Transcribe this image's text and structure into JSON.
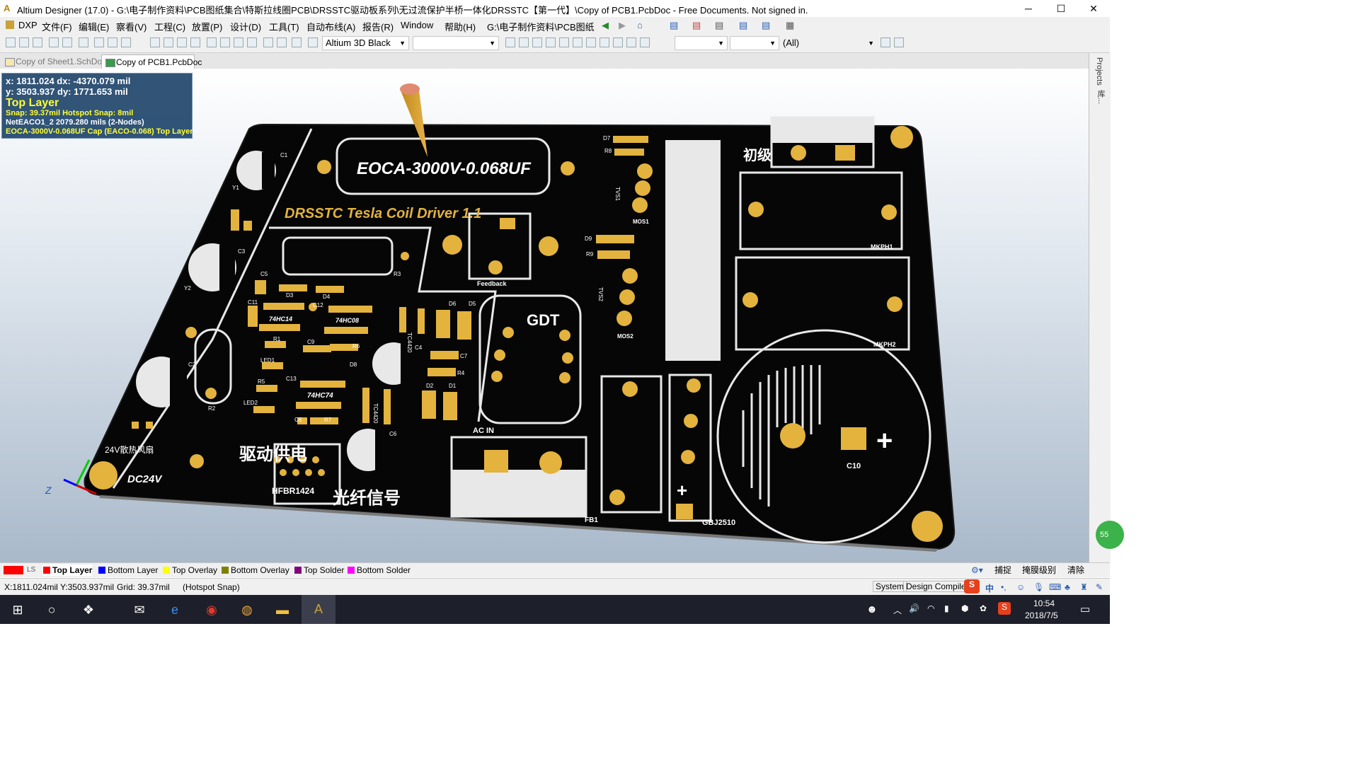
{
  "window": {
    "title": "Altium Designer (17.0) - G:\\电子制作资料\\PCB图纸集合\\特斯拉线圈PCB\\DRSSTC驱动板系列\\无过流保护半桥一体化DRSSTC【第一代】\\Copy of PCB1.PcbDoc - Free Documents. Not signed in.",
    "minimize_icon": "─",
    "maximize_icon": "☐",
    "close_icon": "✕"
  },
  "menu": {
    "items": [
      "DXP",
      "文件(F)",
      "编辑(E)",
      "察看(V)",
      "工程(C)",
      "放置(P)",
      "设计(D)",
      "工具(T)",
      "自动布线(A)",
      "报告(R)",
      "Window",
      "帮助(H)"
    ],
    "path_combo": "G:\\电子制作资料\\PCB图纸"
  },
  "toolbar": {
    "view_config": "Altium 3D Black",
    "filter_combo": "(All)"
  },
  "tabs": [
    {
      "label": "Copy of Sheet1.SchDoc",
      "active": false
    },
    {
      "label": "Copy of PCB1.PcbDoc",
      "active": true
    }
  ],
  "hud": {
    "x_line": "x:  1811.024   dx:  -4370.079 mil",
    "y_line": "y:  3503.937   dy:  1771.653  mil",
    "layer": "Top Layer",
    "snap": "Snap: 39.37mil Hotspot Snap: 8mil",
    "net": "NetEACO1_2    2079.280 mils (2-Nodes)",
    "component": "EOCA-3000V-0.068UF  Cap (EACO-0.068) Top Layer"
  },
  "pcb": {
    "cap_label": "EOCA-3000V-0.068UF",
    "board_title": "DRSSTC Tesla Coil Driver 1.1",
    "labels": {
      "primary": "初级",
      "drive_power": "驱动供电",
      "fiber_signal": "光纤信号",
      "fan": "24V散热风扇",
      "dc24": "DC24V",
      "gdt": "GDT",
      "ac_in": "AC IN",
      "feedback": "Feedback",
      "hfbr": "HFBR1424",
      "c10": "C10",
      "mkph1": "MKPH1",
      "mkph2": "MKPH2",
      "mos1": "MOS1",
      "mos2": "MOS2",
      "gbj": "GBJ2510",
      "fb1": "FB1",
      "hc14": "74HC14",
      "hc08": "74HC08",
      "hc74": "74HC74",
      "tc1": "TC4420",
      "tc2": "TC4420",
      "plus": "+",
      "tvs1": "TVS1",
      "tvs2": "TVS2",
      "c1": "C1",
      "c2": "C2",
      "c3": "C3",
      "c4": "C4",
      "c5": "C5",
      "c6": "C6",
      "c7": "C7",
      "c8": "C8",
      "c9": "C9",
      "c11": "C11",
      "c12": "C12",
      "c13": "C13",
      "r1": "R1",
      "r2": "R2",
      "r3": "R3",
      "r4": "R4",
      "r5": "R5",
      "r6": "R6",
      "r7": "R7",
      "r8": "R8",
      "r9": "R9",
      "d1": "D1",
      "d2": "D2",
      "d3": "D3",
      "d4": "D4",
      "d5": "D5",
      "d6": "D6",
      "d7": "D7",
      "d8": "D8",
      "d9": "D9",
      "y1": "Y1",
      "y2": "Y2",
      "led1": "LED1",
      "led2": "LED2"
    },
    "axis_z": "Z"
  },
  "layers": [
    {
      "label": "LS",
      "color": "#ff0000"
    },
    {
      "label": "Top Layer",
      "color": "#ff0000",
      "active": true
    },
    {
      "label": "Bottom Layer",
      "color": "#0000ff"
    },
    {
      "label": "Top Overlay",
      "color": "#ffff00"
    },
    {
      "label": "Bottom Overlay",
      "color": "#808000"
    },
    {
      "label": "Top Solder",
      "color": "#800080"
    },
    {
      "label": "Bottom Solder",
      "color": "#ff00ff"
    }
  ],
  "layer_actions": [
    "捕捉",
    "掩膜级别",
    "清除"
  ],
  "status": {
    "coords": "X:1811.024mil Y:3503.937mil",
    "grid": "Grid: 39.37mil",
    "snap": "(Hotspot Snap)",
    "system": "System",
    "design_compiler": "Design Compiler"
  },
  "right_panel": [
    "Projects",
    "库..."
  ],
  "taskbar": {
    "time": "10:54",
    "date": "2018/7/5",
    "ime": "中",
    "badge": "55"
  }
}
